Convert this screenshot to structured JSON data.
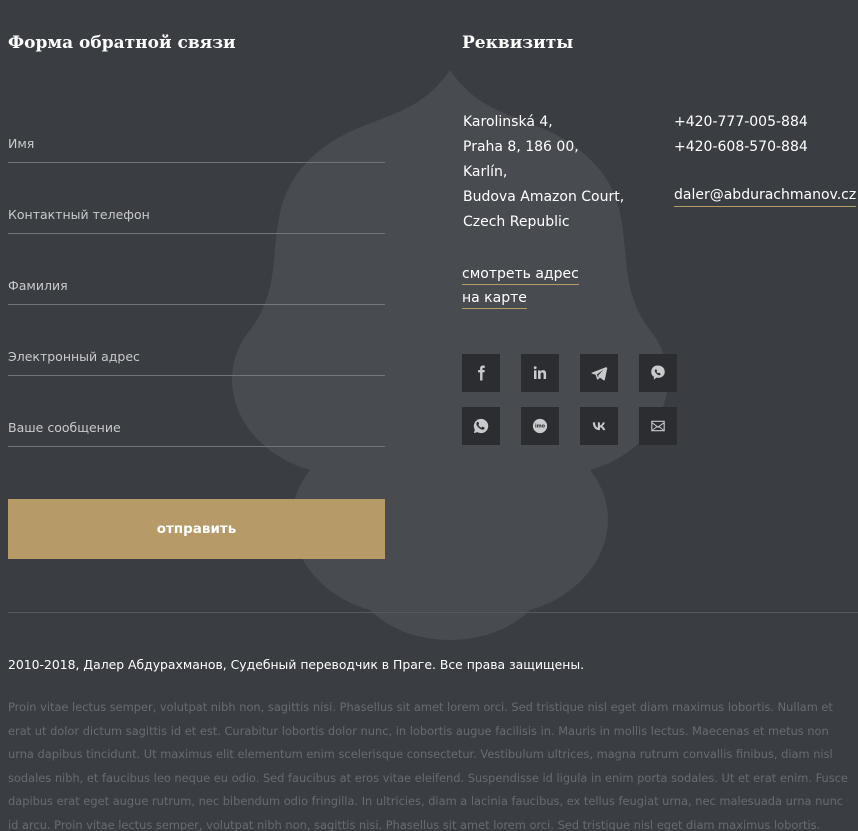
{
  "form": {
    "title": "Форма обратной связи",
    "fields": [
      {
        "placeholder": "Имя"
      },
      {
        "placeholder": "Контактный телефон"
      },
      {
        "placeholder": "Фамилия"
      },
      {
        "placeholder": "Электронный адрес"
      },
      {
        "placeholder": "Ваше сообщение"
      }
    ],
    "submit_label": "отправить"
  },
  "requisites": {
    "title": "Реквизиты",
    "address": [
      "Karolinská 4,",
      "Praha 8, 186 00,",
      "Karlín,",
      "Budova Amazon Court,",
      "Czech Republic"
    ],
    "phones": [
      "+420-777-005-884",
      "+420-608-570-884"
    ],
    "email": "daler@abdurachmanov.cz",
    "map_link": [
      "смотреть адрес",
      "на карте"
    ],
    "social": [
      "facebook-icon",
      "linkedin-icon",
      "telegram-icon",
      "viber-icon",
      "whatsapp-icon",
      "imo-icon",
      "vk-icon",
      "mail-icon"
    ]
  },
  "footer": {
    "copyright": "2010-2018, Далер Абдурахманов, Судебный переводчик в Праге. Все права защищены.",
    "lorem": "Proin vitae lectus semper, volutpat nibh non, sagittis nisi. Phasellus sit amet lorem orci. Sed tristique nisl eget diam maximus lobortis. Nullam et erat ut dolor dictum sagittis id et est. Curabitur lobortis dolor nunc, in lobortis augue facilisis in. Mauris in mollis lectus. Maecenas et metus non urna dapibus tincidunt. Ut maximus elit elementum enim scelerisque consectetur. Vestibulum ultrices, magna rutrum convallis finibus, diam nisl sodales nibh, et faucibus leo neque eu odio. Sed faucibus at eros vitae eleifend. Suspendisse id ligula in enim porta sodales. Ut et erat enim. Fusce dapibus erat eget augue rutrum, nec bibendum odio fringilla. In ultricies, diam a lacinia faucibus, ex tellus feugiat urna, nec malesuada urna nunc id arcu. Proin vitae lectus semper, volutpat nibh non, sagittis nisi. Phasellus sit amet lorem orci. Sed tristique nisl eget diam maximus lobortis. Nullam et erat ut dolor dictum"
  }
}
